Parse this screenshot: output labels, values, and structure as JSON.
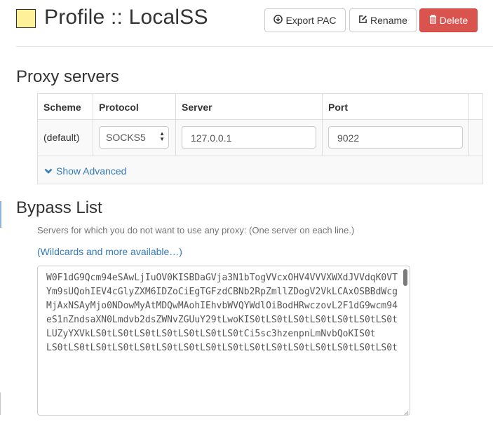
{
  "header": {
    "title": "Profile :: LocalSS",
    "profile_color": "#fff19a",
    "buttons": {
      "export_pac": "Export PAC",
      "rename": "Rename",
      "delete": "Delete"
    }
  },
  "proxy_servers": {
    "title": "Proxy servers",
    "columns": [
      "Scheme",
      "Protocol",
      "Server",
      "Port"
    ],
    "rows": [
      {
        "scheme": "(default)",
        "protocol": "SOCKS5",
        "server": "127.0.0.1",
        "port": "9022"
      }
    ],
    "show_advanced": "Show Advanced"
  },
  "bypass": {
    "title": "Bypass List",
    "help": "Servers for which you do not want to use any proxy: (One server on each line.)",
    "wildcards_link": "(Wildcards and more available…)",
    "textarea_value": "W0F1dG9Qcm94eSAwLjIuOV0KISBDaGVja3N1bTogVVcxOHV4VVVXWXdJVVdqK0VT\nYm9sUQohIEV4cGlyZXM6IDZoCiEgTGFzdCBNb2RpZmllZDogV2VkLCAxOSBBdWcg\nMjAxNSAyMjo0NDowMyAtMDQwMAohIEhvbWVQYWdlOiBodHRwczovL2F1dG9wcm94\neS1nZndsaXN0Lmdvb2dsZWNvZGUuY29tLwoKIS0tLS0tLS0tLS0tLS0tLS0tLS0t\nLUZyYXVkLS0tLS0tLS0tLS0tLS0tLS0tLS0tCi5sc3hzenpnLmNvbQoKIS0t\nLS0tLS0tLS0tLS0tLS0tLS0tLS0tLS0tLS0tLS0tLS0tLS0tLS0tLS0tLS0tLS0t"
  },
  "colors": {
    "link": "#337ab7",
    "danger": "#d9534f",
    "text": "#333333"
  },
  "icons": {
    "export": "download-circle-icon",
    "rename": "edit-square-icon",
    "delete": "trash-icon",
    "advanced": "chevron-down-icon"
  }
}
